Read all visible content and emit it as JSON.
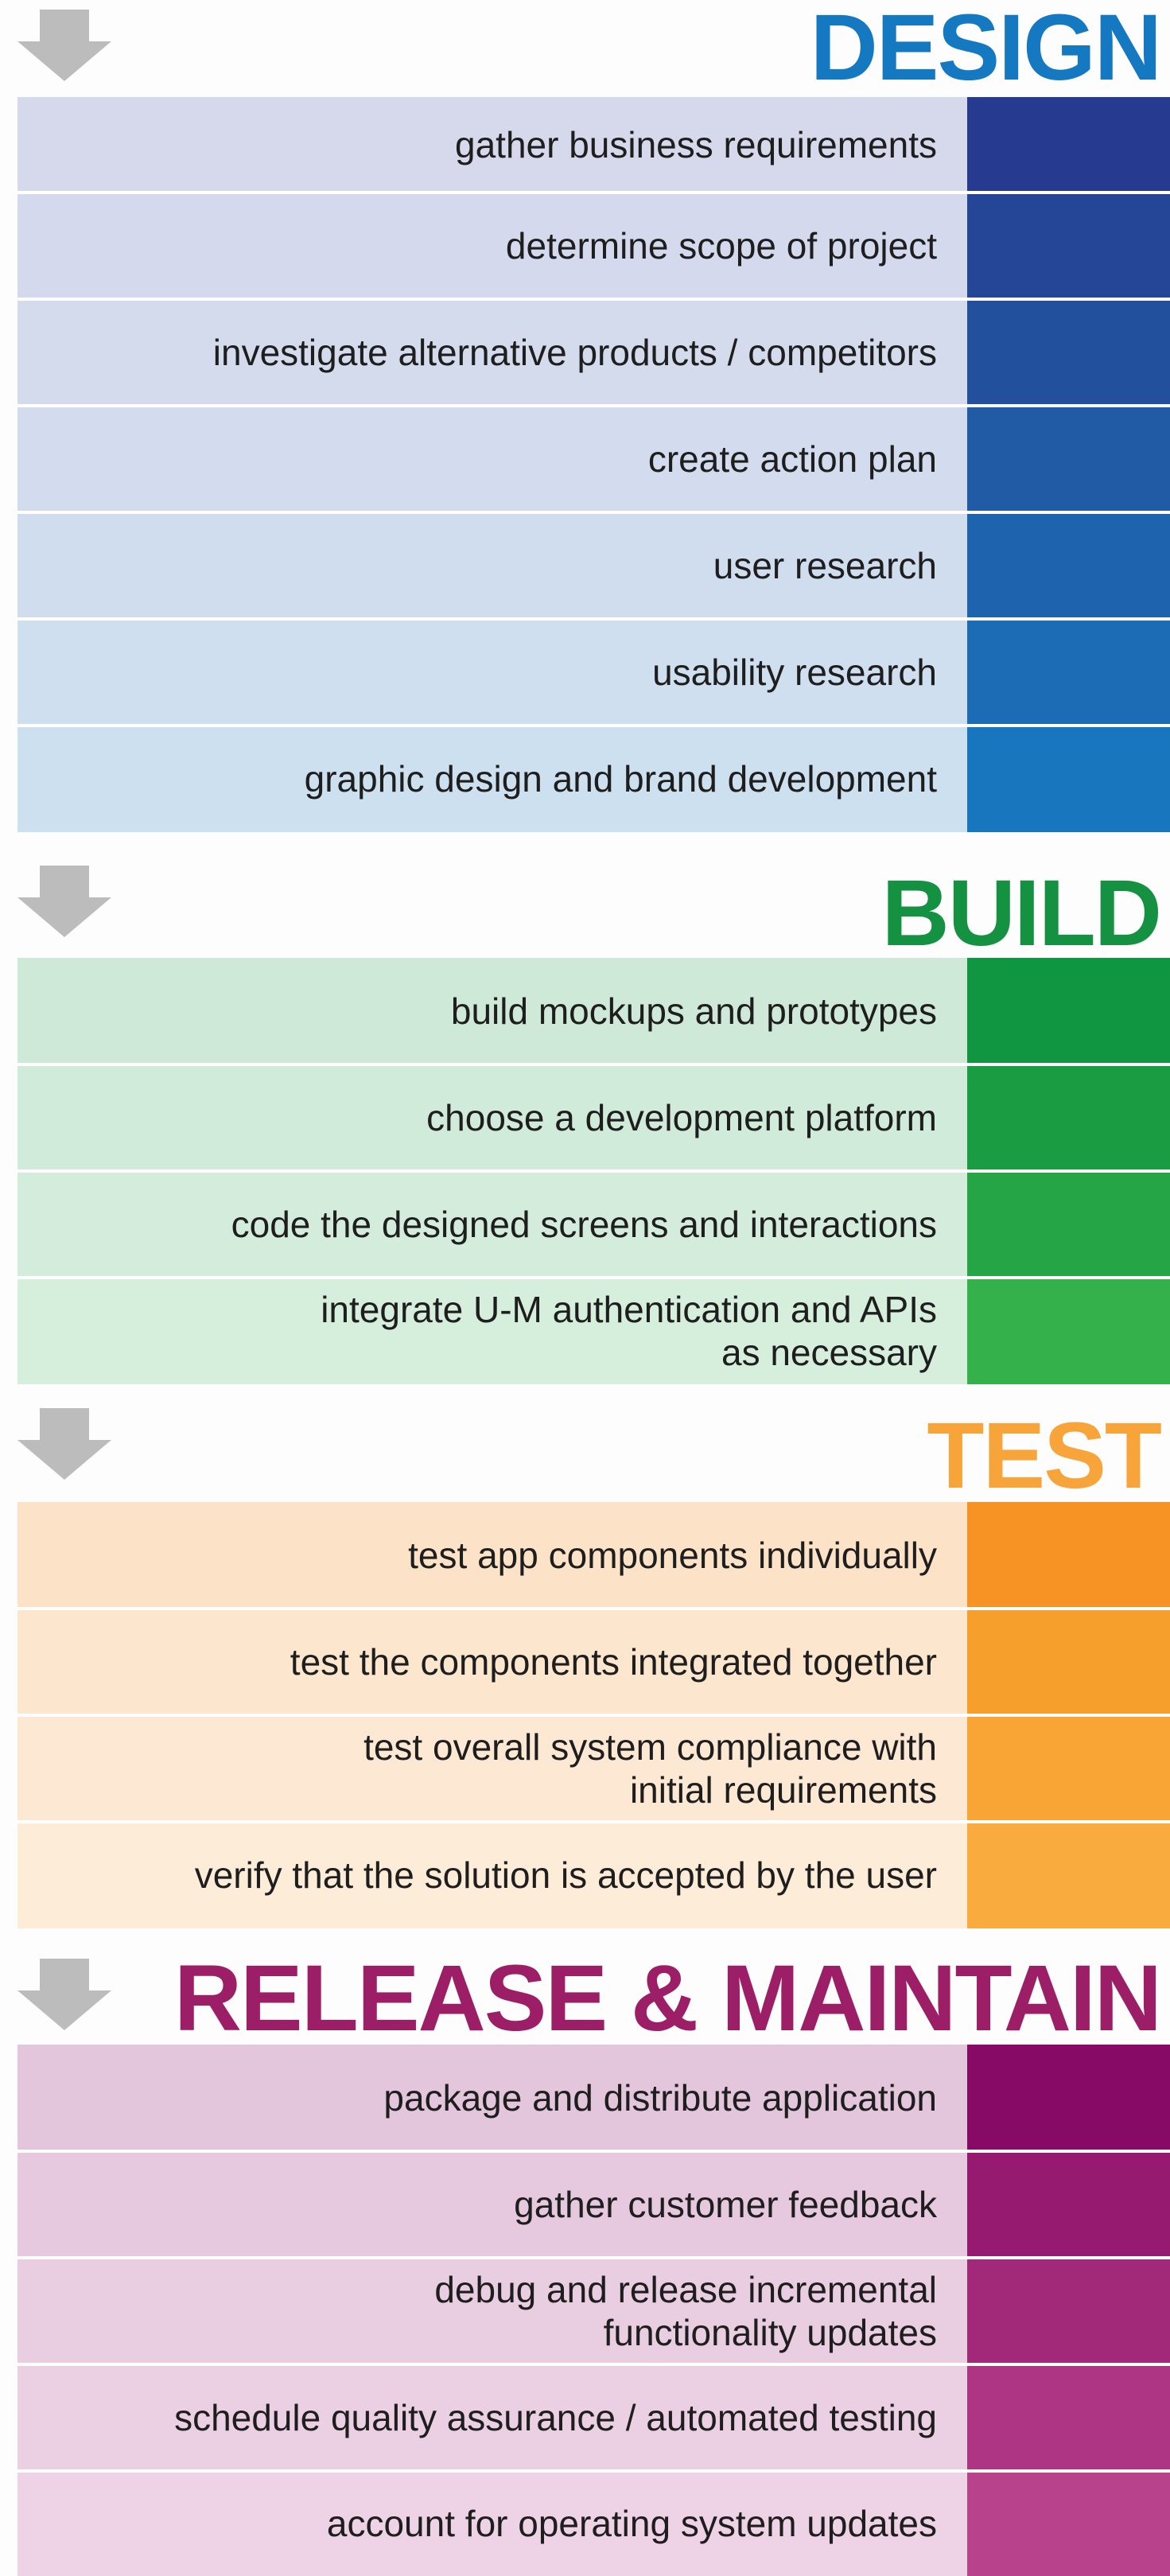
{
  "phases": [
    {
      "title": "DESIGN",
      "title_color": "#1479c0",
      "arrow_color": "#bcbcbc",
      "label_bg_top": "#d6d8ec",
      "label_bg_bottom": "#cde0f0",
      "items": [
        {
          "text": "gather business requirements",
          "color": "#263a8f"
        },
        {
          "text": "determine scope of project",
          "color": "#254596"
        },
        {
          "text": "investigate alternative products / competitors",
          "color": "#22509d"
        },
        {
          "text": "create action plan",
          "color": "#215aa5"
        },
        {
          "text": "user research",
          "color": "#1e63ae"
        },
        {
          "text": "usability research",
          "color": "#1c6bb5"
        },
        {
          "text": "graphic design and brand development",
          "color": "#1776bd"
        }
      ]
    },
    {
      "title": "BUILD",
      "title_color": "#149141",
      "arrow_color": "#bcbcbc",
      "label_bg_top": "#cfe9d9",
      "label_bg_bottom": "#d6eedc",
      "items": [
        {
          "text": "build mockups and prototypes",
          "color": "#109640"
        },
        {
          "text": "choose a development platform",
          "color": "#1a9c43"
        },
        {
          "text": "code the designed screens and interactions",
          "color": "#26a547"
        },
        {
          "text": "integrate U-M authentication and APIs\nas necessary",
          "color": "#35b14b"
        }
      ]
    },
    {
      "title": "TEST",
      "title_color": "#f7a53a",
      "arrow_color": "#bcbcbc",
      "label_bg_top": "#fce3c8",
      "label_bg_bottom": "#fdecd8",
      "items": [
        {
          "text": "test app components individually",
          "color": "#f69324"
        },
        {
          "text": "test the components integrated together",
          "color": "#f79f2d"
        },
        {
          "text": "test overall system compliance with\ninitial requirements",
          "color": "#f8a535"
        },
        {
          "text": "verify that the solution is accepted by the user",
          "color": "#f9ac3d"
        }
      ]
    },
    {
      "title": "RELEASE & MAINTAIN",
      "title_color": "#9b1e67",
      "arrow_color": "#bcbcbc",
      "label_bg_top": "#e3c6dc",
      "label_bg_bottom": "#eed3e6",
      "items": [
        {
          "text": "package and distribute application",
          "color": "#870b66"
        },
        {
          "text": "gather customer feedback",
          "color": "#961a70"
        },
        {
          "text": "debug and release incremental\nfunctionality updates",
          "color": "#a2297a"
        },
        {
          "text": "schedule quality assurance / automated testing",
          "color": "#ad3583"
        },
        {
          "text": "account for operating system updates",
          "color": "#b8428b"
        }
      ]
    }
  ]
}
